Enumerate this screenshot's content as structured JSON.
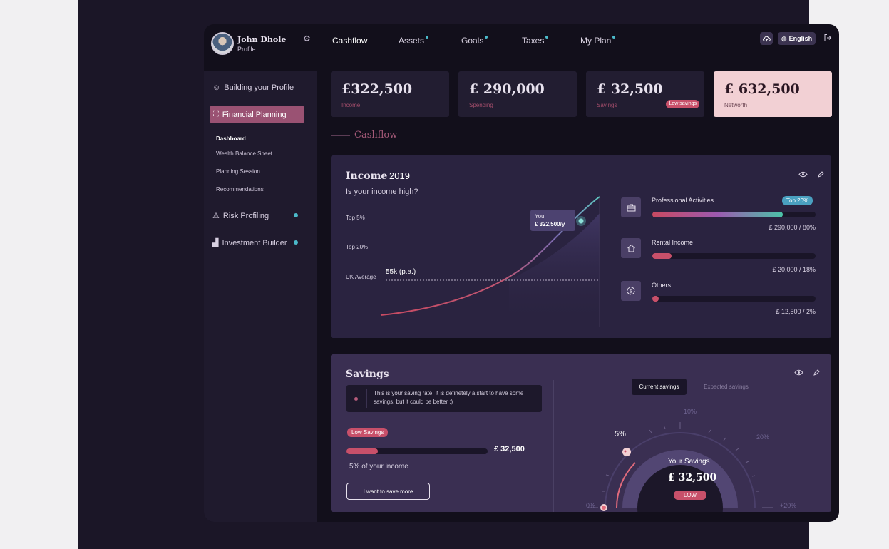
{
  "user": {
    "name": "John Dhole",
    "role": "Profile"
  },
  "nav": [
    {
      "label": "Cashflow"
    },
    {
      "label": "Assets"
    },
    {
      "label": "Goals"
    },
    {
      "label": "Taxes"
    },
    {
      "label": "My Plan"
    }
  ],
  "header": {
    "language": "English"
  },
  "sidebar": {
    "building": "Building your Profile",
    "financial": "Financial Planning",
    "sub": [
      "Dashboard",
      "Wealth Balance Sheet",
      "Planning Session",
      "Recommendations"
    ],
    "risk": "Risk Profiling",
    "investment": "Investment Builder"
  },
  "stats": [
    {
      "value": "£322,500",
      "label": "Income"
    },
    {
      "value": "£ 290,000",
      "label": "Spending"
    },
    {
      "value": "£ 32,500",
      "label": "Savings",
      "tag": "Low savings"
    },
    {
      "value": "£ 632,500",
      "label": "Networth"
    }
  ],
  "section_title": "Cashflow",
  "income": {
    "title": "Income",
    "year": "2019",
    "question": "Is your income high?",
    "levels": [
      "Top 5%",
      "Top 20%",
      "UK Average"
    ],
    "average_label": "55k (p.a.)",
    "you_label": "You",
    "you_value": "£ 322,500/y",
    "sources": [
      {
        "name": "Professional Activities",
        "tag": "Top 20%",
        "amount": "£ 290,000 /  80%",
        "share": 0.8
      },
      {
        "name": "Rental Income",
        "amount": "£ 20,000 /  18%",
        "share": 0.12
      },
      {
        "name": "Others",
        "amount": "£ 12,500 /  2%",
        "share": 0.04
      }
    ]
  },
  "savings": {
    "title": "Savings",
    "note": "This is your saving rate. It is definetely a start to have some savings, but it could be better :)",
    "tag": "Low Savings",
    "amount": "£ 32,500",
    "rate_share": 0.22,
    "percent_text": "5% of your income",
    "button": "I want to save more",
    "toggle_current": "Current savings",
    "toggle_expected": "Expected savings",
    "gauge": {
      "center_label": "Your Savings",
      "center_value": "£ 32,500",
      "level": "LOW",
      "marker_label": "5%",
      "scale": [
        "0%",
        "10%",
        "20%",
        "+20%"
      ],
      "value_percent": 5
    }
  },
  "colors": {
    "accent": "#9a5273",
    "teal": "#4bb9c9",
    "low": "#c8506a",
    "networth_card": "#f2d0d4"
  }
}
